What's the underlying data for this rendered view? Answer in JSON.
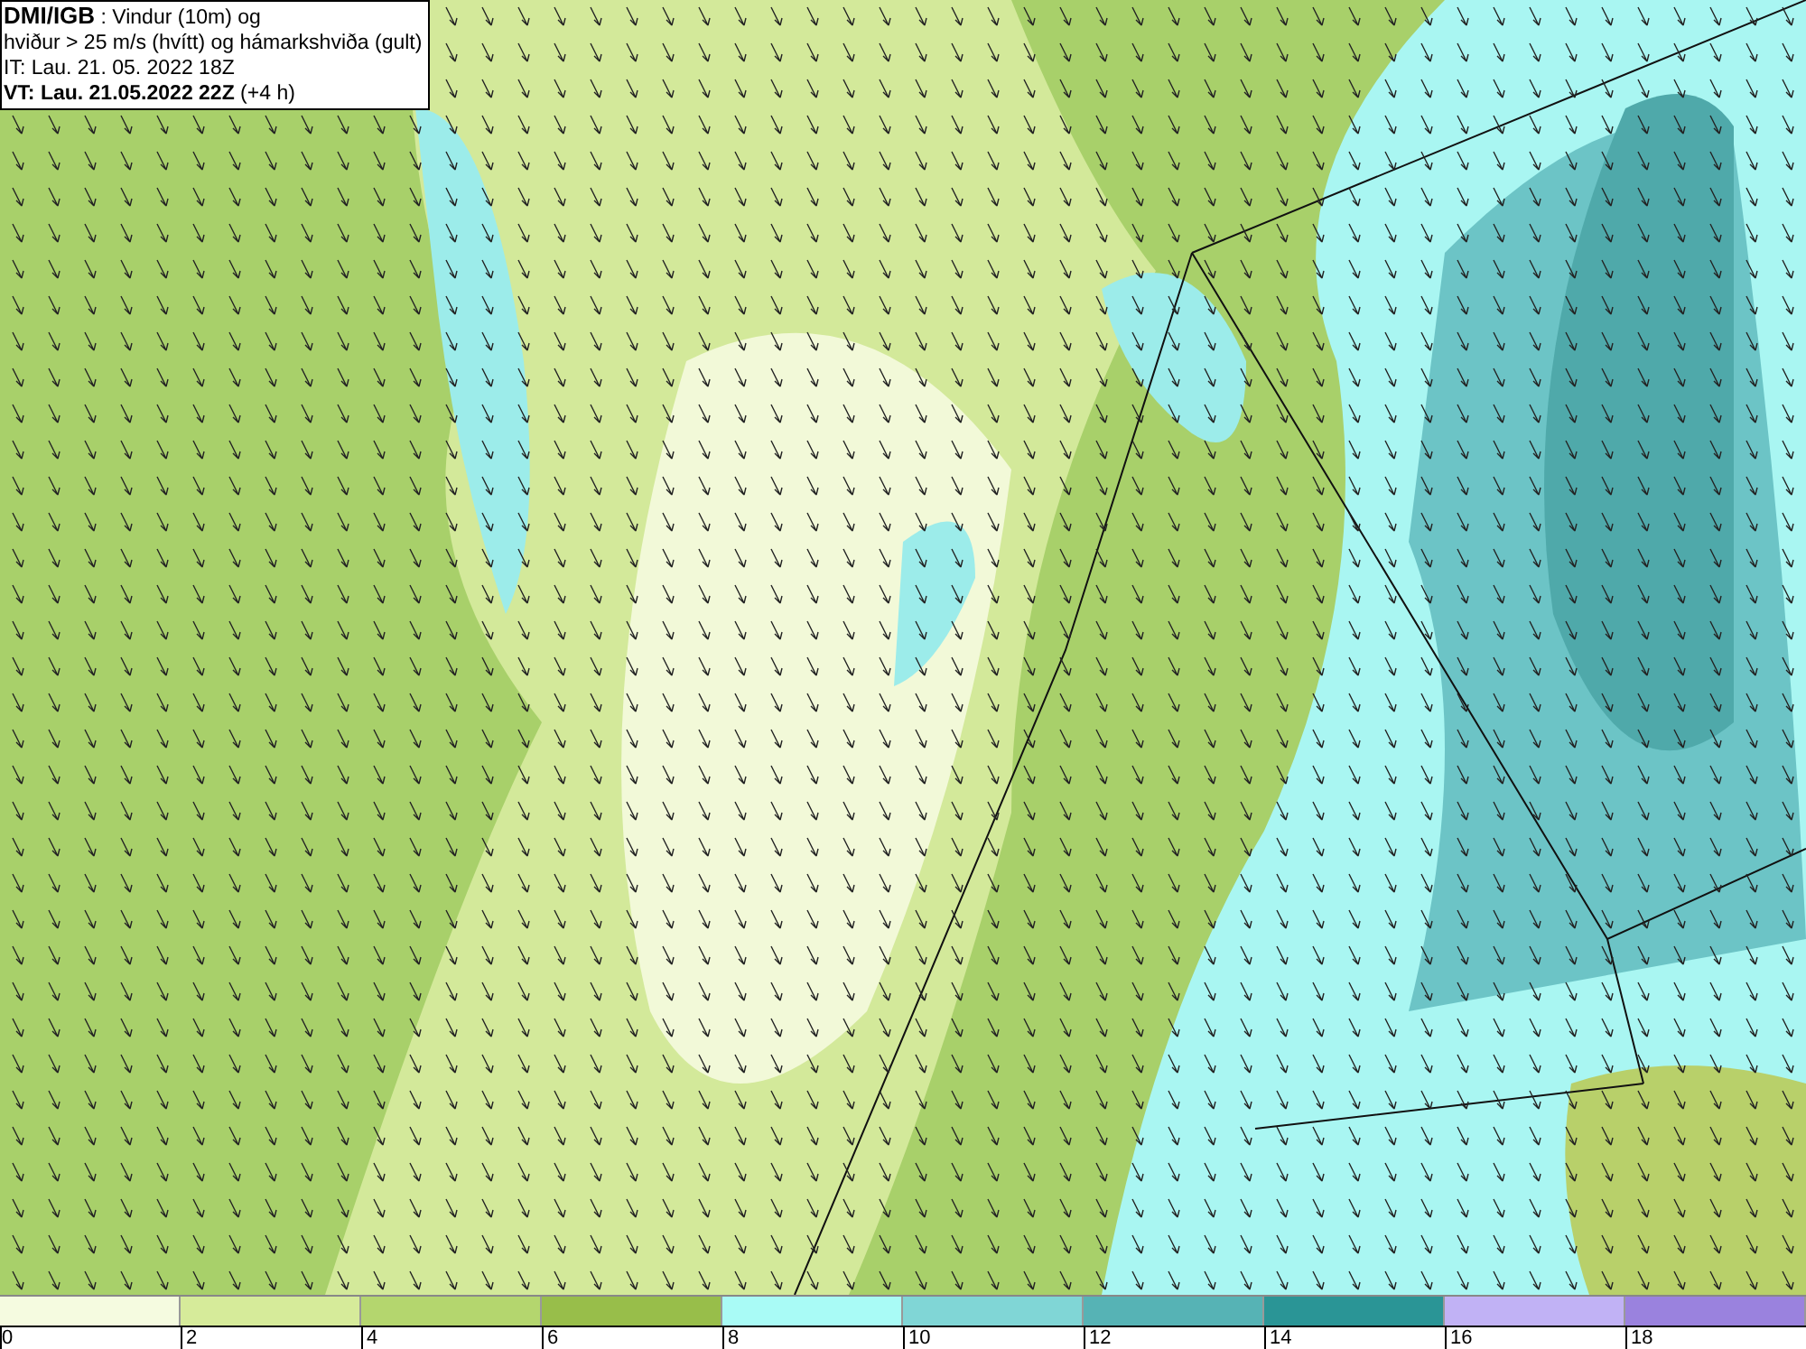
{
  "legend": {
    "lines": [
      "**DMI/IGB** : Vindur (10m) og",
      "hviður > 25 m/s (hvítt) og hámarkshviða (gult)",
      "IT: Lau. 21. 05. 2022 18Z",
      "**VT: Lau. 21.05.2022 22Z** (+4 h)"
    ]
  },
  "colorbar": {
    "segments": [
      {
        "color": "#f5fbe0"
      },
      {
        "color": "#d6eb9a"
      },
      {
        "color": "#b4d66e"
      },
      {
        "color": "#98be4a"
      },
      {
        "color": "#a9fbf6"
      },
      {
        "color": "#80d6d6"
      },
      {
        "color": "#56b3b5"
      },
      {
        "color": "#2a9596"
      },
      {
        "color": "#c1b2f5"
      },
      {
        "color": "#9a82de"
      }
    ],
    "ticks": [
      "0",
      "2",
      "4",
      "6",
      "8",
      "10",
      "12",
      "14",
      "16",
      "18"
    ]
  }
}
